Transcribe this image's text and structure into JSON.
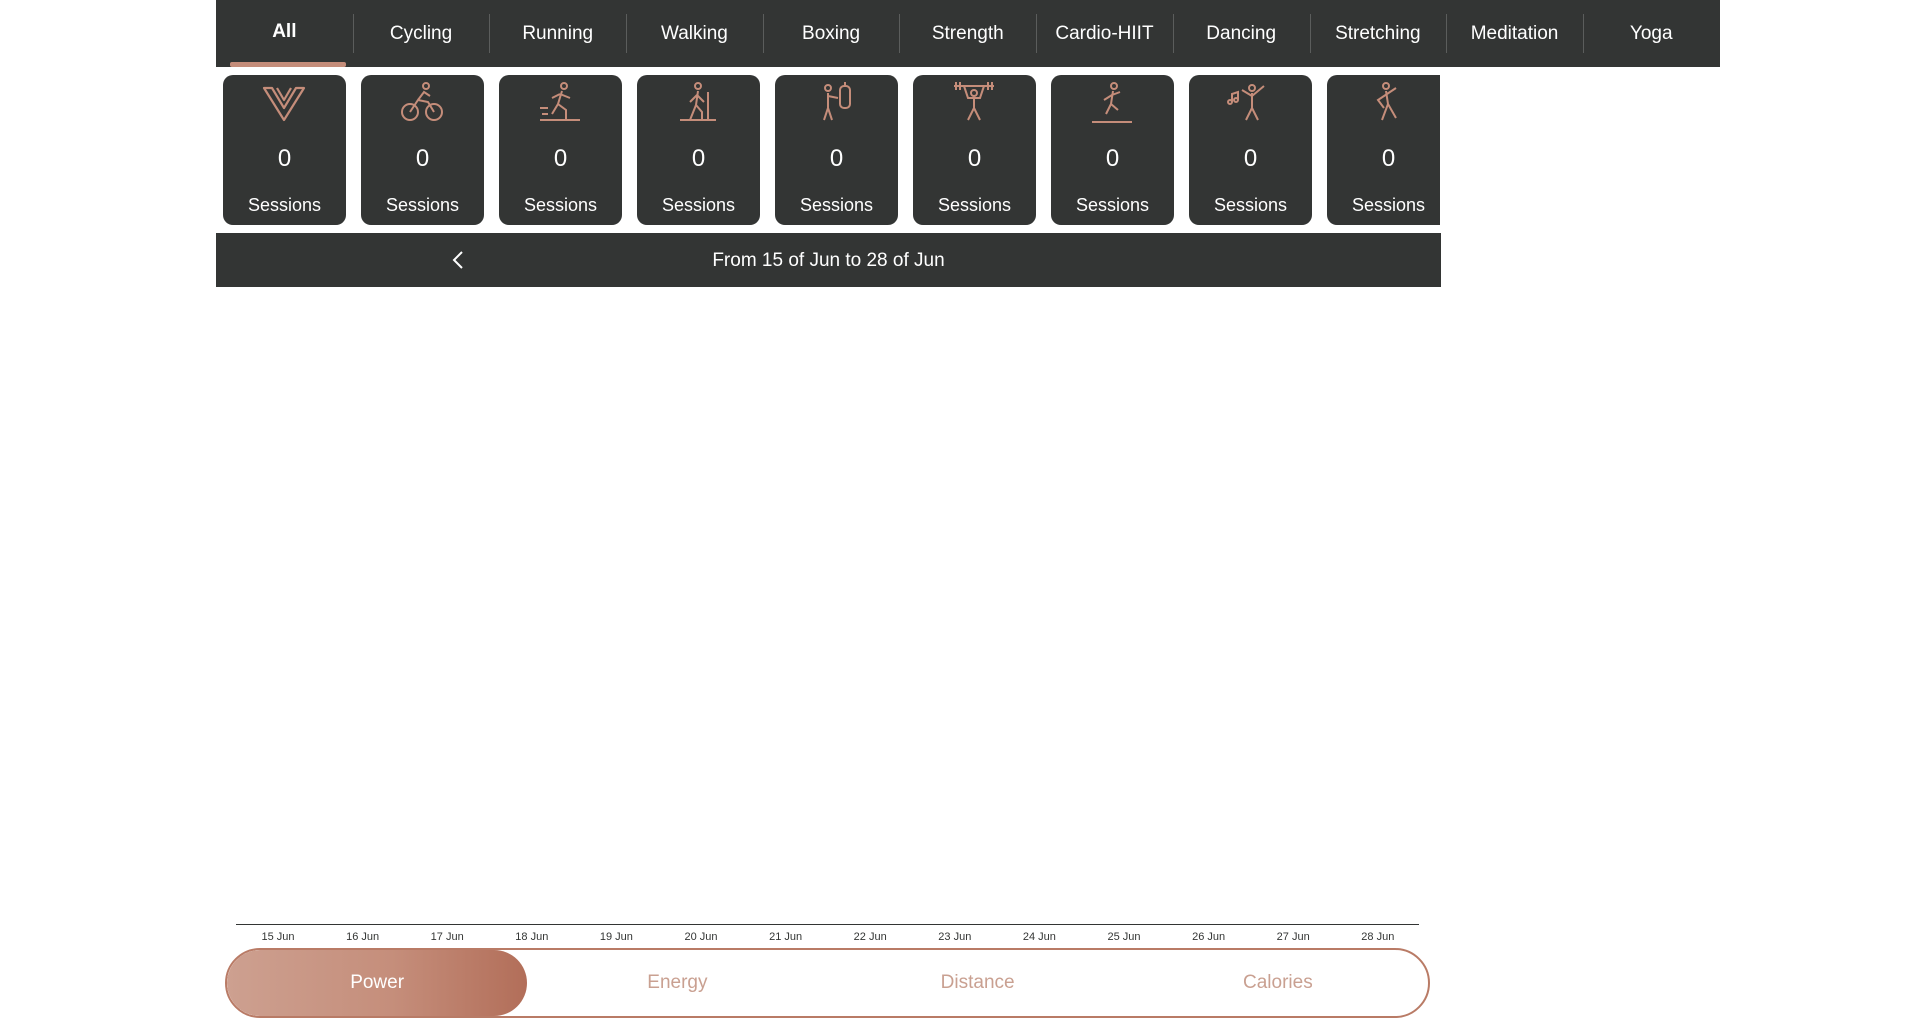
{
  "tabs": [
    {
      "label": "All",
      "active": true
    },
    {
      "label": "Cycling"
    },
    {
      "label": "Running"
    },
    {
      "label": "Walking"
    },
    {
      "label": "Boxing"
    },
    {
      "label": "Strength"
    },
    {
      "label": "Cardio-HIIT"
    },
    {
      "label": "Dancing"
    },
    {
      "label": "Stretching"
    },
    {
      "label": "Meditation"
    },
    {
      "label": "Yoga"
    }
  ],
  "cards": [
    {
      "icon": "all-activities-logo-icon",
      "count": "0",
      "label": "Sessions"
    },
    {
      "icon": "cycling-icon",
      "count": "0",
      "label": "Sessions"
    },
    {
      "icon": "running-icon",
      "count": "0",
      "label": "Sessions"
    },
    {
      "icon": "walking-icon",
      "count": "0",
      "label": "Sessions"
    },
    {
      "icon": "boxing-icon",
      "count": "0",
      "label": "Sessions"
    },
    {
      "icon": "strength-icon",
      "count": "0",
      "label": "Sessions"
    },
    {
      "icon": "cardio-hiit-icon",
      "count": "0",
      "label": "Sessions"
    },
    {
      "icon": "dancing-icon",
      "count": "0",
      "label": "Sessions"
    },
    {
      "icon": "stretching-icon",
      "count": "0",
      "label": "Sessions"
    }
  ],
  "date_range": {
    "text": "From 15 of Jun to 28 of Jun"
  },
  "chart_data": {
    "type": "bar",
    "categories": [
      "15 Jun",
      "16 Jun",
      "17 Jun",
      "18 Jun",
      "19 Jun",
      "20 Jun",
      "21 Jun",
      "22 Jun",
      "23 Jun",
      "24 Jun",
      "25 Jun",
      "26 Jun",
      "27 Jun",
      "28 Jun"
    ],
    "values": [
      0,
      0,
      0,
      0,
      0,
      0,
      0,
      0,
      0,
      0,
      0,
      0,
      0,
      0
    ]
  },
  "metrics": [
    {
      "label": "Power",
      "active": true
    },
    {
      "label": "Energy"
    },
    {
      "label": "Distance"
    },
    {
      "label": "Calories"
    }
  ],
  "colors": {
    "dark": "#333534",
    "accent": "#c58d7a",
    "muted_text": "#c9a091"
  }
}
